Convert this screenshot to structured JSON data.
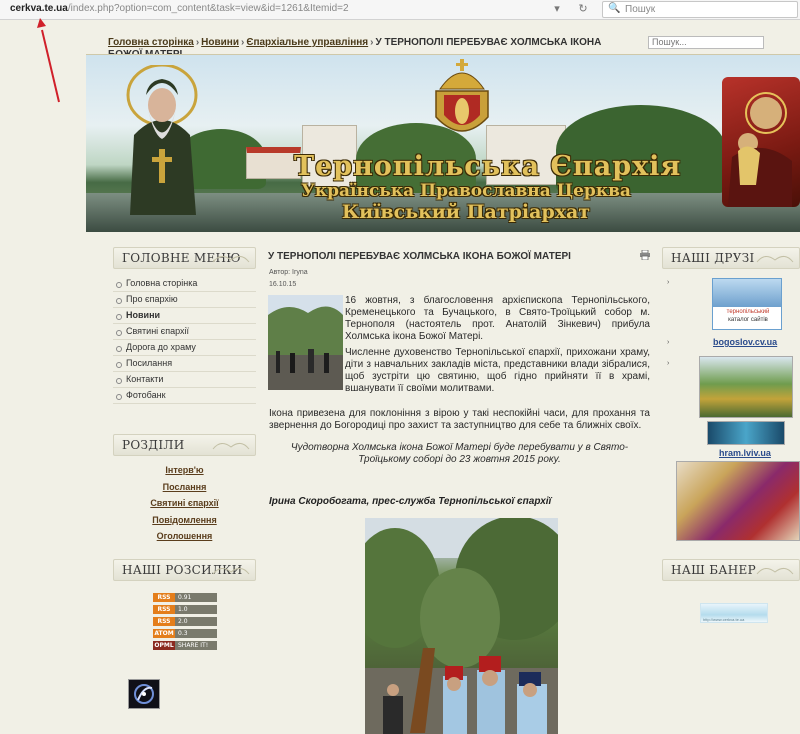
{
  "browser": {
    "url_domain": "cerkva.te.ua",
    "url_rest": "/index.php?option=com_content&task=view&id=1261&Itemid=2",
    "search_placeholder": "Пошук"
  },
  "breadcrumb": {
    "items": [
      "Головна сторінка",
      "Новини",
      "Єпархіальне управління"
    ],
    "current": "У ТЕРНОПОЛІ ПЕРЕБУВАЄ ХОЛМСЬКА ІКОНА БОЖОЇ МАТЕРІ",
    "separator": "›"
  },
  "site_search_placeholder": "Пошук...",
  "banner": {
    "line1": "Тернопільська Єпархія",
    "line2": "Українська Православна Церква",
    "line3": "Київський Патріархат"
  },
  "main_menu": {
    "title": "ГОЛОВНЕ МЕНЮ",
    "items": [
      "Головна сторінка",
      "Про єпархію",
      "Новини",
      "Святині єпархії",
      "Дорога до храму",
      "Посилання",
      "Контакти",
      "Фотобанк"
    ]
  },
  "sections": {
    "title": "РОЗДІЛИ",
    "items": [
      "Інтерв'ю",
      "Послання",
      "Святині єпархії",
      "Повідомлення",
      "Оголошення"
    ]
  },
  "feeds": {
    "title": "НАШІ РОЗСИЛКИ",
    "buttons": [
      {
        "l": "RSS",
        "r": "0.91"
      },
      {
        "l": "RSS",
        "r": "1.0"
      },
      {
        "l": "RSS",
        "r": "2.0"
      },
      {
        "l": "ATOM",
        "r": "0.3"
      },
      {
        "l": "OPML",
        "r": "SHARE IT!"
      }
    ]
  },
  "article": {
    "title": "У ТЕРНОПОЛІ ПЕРЕБУВАЄ ХОЛМСЬКА ІКОНА БОЖОЇ МАТЕРІ",
    "author": "Автор: Iryna",
    "date": "16.10.15",
    "p1": "16 жовтня, з благословення архієпископа Тернопільського, Кременецького та Бучацького, в Свято-Троїцький собор м. Тернополя (настоятель прот. Анатолій Зінкевич) прибула Холмська ікона Божої Матері.",
    "p2": "Численне духовенство Тернопільської єпархії, прихожани храму, діти з навчальних закладів міста, представники влади зібралися, щоб зустріти цю святиню, щоб гідно прийняти її в храмі, вшанувати її своїми молитвами.",
    "p3": "Ікона привезена для поклоніння з вірою у такі неспокійні часи, для прохання та звернення до Богородиці про захист та заступництво для себе та ближніх своїх.",
    "p4": "Чудотворна Холмська ікона Божої Матері буде перебувати у в Свято-Троїцькому соборі до 23 жовтня 2015 року.",
    "signature": "Ірина Скоробогата, прес-служба Тернопільської єпархії"
  },
  "friends": {
    "title": "НАШІ ДРУЗІ",
    "catalog_line1": "тернопільський",
    "catalog_line2": "каталог сайтів",
    "link1": "bogoslov.cv.ua",
    "link2": "hram.lviv.ua"
  },
  "our_banner": {
    "title": "НАШ БАНЕР",
    "caption": "http://www.cerkva.te.ua"
  },
  "colors": {
    "accent_link": "#5a3d1c",
    "friend_link": "#2a4b8c",
    "banner_gold": "#e2c15c"
  }
}
